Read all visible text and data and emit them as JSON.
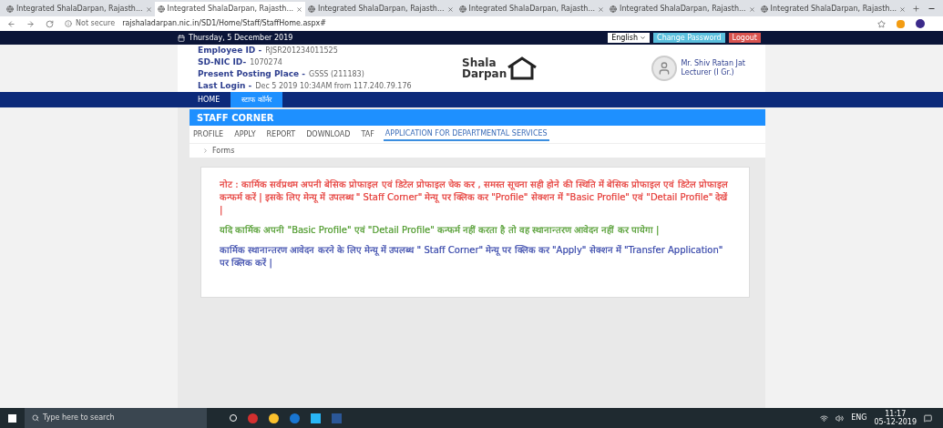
{
  "browser": {
    "tabs": [
      {
        "title": "Integrated ShalaDarpan, Rajasth...",
        "selected": false
      },
      {
        "title": "Integrated ShalaDarpan, Rajasth...",
        "selected": true
      },
      {
        "title": "Integrated ShalaDarpan, Rajasth...",
        "selected": false
      },
      {
        "title": "Integrated ShalaDarpan, Rajasth...",
        "selected": false
      },
      {
        "title": "Integrated ShalaDarpan, Rajasth...",
        "selected": false
      },
      {
        "title": "Integrated ShalaDarpan, Rajasth...",
        "selected": false
      }
    ],
    "security": "Not secure",
    "url": "rajshaladarpan.nic.in/SD1/Home/Staff/StaffHome.aspx#"
  },
  "top_bar": {
    "date": "Thursday, 5 December 2019",
    "language": "English",
    "buttons": [
      {
        "label": "Change Password",
        "kind": "info"
      },
      {
        "label": "Logout",
        "kind": "danger"
      }
    ]
  },
  "header": {
    "fields": [
      {
        "label": "Employee ID -",
        "value": "RJSR201234011525"
      },
      {
        "label": "SD-NIC ID-",
        "value": "1070274"
      },
      {
        "label": "Present Posting Place -",
        "value": "GSSS (211183)"
      },
      {
        "label": "Last Login -",
        "value": "Dec 5 2019 10:34AM from 117.240.79.176"
      }
    ],
    "logo": {
      "line_1": "Shala",
      "line_2": "Darpan"
    },
    "user": {
      "name": "Mr. Shiv Ratan Jat",
      "role": "Lecturer (I Gr.)"
    }
  },
  "nav": [
    {
      "label": "HOME",
      "selected": false
    },
    {
      "label": "स्टाफ कॉर्नर",
      "selected": true
    }
  ],
  "panel": {
    "title": "STAFF CORNER",
    "tabs": [
      {
        "label": "PROFILE",
        "selected": false
      },
      {
        "label": "APPLY",
        "selected": false
      },
      {
        "label": "REPORT",
        "selected": false
      },
      {
        "label": "DOWNLOAD",
        "selected": false
      },
      {
        "label": "TAF",
        "selected": false
      },
      {
        "label": "APPLICATION FOR DEPARTMENTAL SERVICES",
        "selected": true
      }
    ],
    "breadcrumb": "Forms"
  },
  "notes": [
    {
      "text": "नोट : कार्मिक सर्वप्रथम अपनी बेसिक प्रोफाइल एवं डिटेल प्रोफाइल चेक कर , समस्त सूचना सही होने की स्थिति में बेसिक प्रोफाइल एवं डिटेल प्रोफाइल कन्फर्म करें | इसके लिए मेन्यू में उपलब्ध \" Staff Corner\" मेन्यू पर क्लिक कर \"Profile\" सेक्शन में \"Basic Profile\" एवं \"Detail Profile\" देखें |",
      "color": "#e53935"
    },
    {
      "text": "यदि कार्मिक अपनी \"Basic Profile\" एवं \"Detail Profile\" कन्फर्म नहीं करता है तो वह स्थानान्तरण आवेदन नहीं कर पायेगा |",
      "color": "#4e9a2c"
    },
    {
      "text": "कार्मिक स्थानान्तरण आवेदन करने के लिए मेन्यू में उपलब्ध \" Staff Corner\" मेन्यू पर क्लिक कर \"Apply\" सेक्शन में \"Transfer Application\" पर क्लिक करें |",
      "color": "#3949ab"
    }
  ],
  "taskbar": {
    "search_placeholder": "Type here to search",
    "language": "ENG",
    "time": "11:17",
    "date": "05-12-2019"
  }
}
